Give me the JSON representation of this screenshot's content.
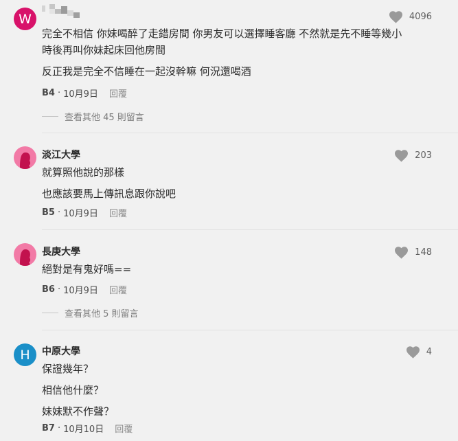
{
  "comments": [
    {
      "avatar_letter": "W",
      "avatar_color": "#d8126a",
      "author": "",
      "likes": "4096",
      "lines": [
        "完全不相信 你妹喝醉了走錯房間 你男友可以選擇睡客廳 不然就是先不睡等幾小",
        "時後再叫你妹起床回他房間",
        "反正我是完全不信睡在一起沒幹嘛 何況還喝酒"
      ],
      "floor": "B4",
      "date": "10月9日",
      "reply_label": "回覆",
      "more_replies": "查看其他 45 則留言"
    },
    {
      "avatar_color": "#f27aa6",
      "author": "淡江大學",
      "likes": "203",
      "lines": [
        "就算照他說的那樣",
        "也應該要馬上傳訊息跟你說吧"
      ],
      "floor": "B5",
      "date": "10月9日",
      "reply_label": "回覆"
    },
    {
      "avatar_color": "#f27aa6",
      "author": "長庚大學",
      "likes": "148",
      "lines": [
        "絕對是有鬼好嗎=="
      ],
      "floor": "B6",
      "date": "10月9日",
      "reply_label": "回覆",
      "more_replies": "查看其他 5 則留言"
    },
    {
      "avatar_letter": "H",
      "avatar_color": "#1a8fc8",
      "author": "中原大學",
      "likes": "4",
      "lines": [
        "保證幾年？",
        "相信他什麼？",
        "妹妹默不作聲？"
      ],
      "floor": "B7",
      "date": "10月10日",
      "reply_label": "回覆"
    }
  ],
  "colors": {
    "background": "#f1f1f1",
    "heart": "#9a9a9a",
    "female_avatar_figure": "#c2124e"
  }
}
